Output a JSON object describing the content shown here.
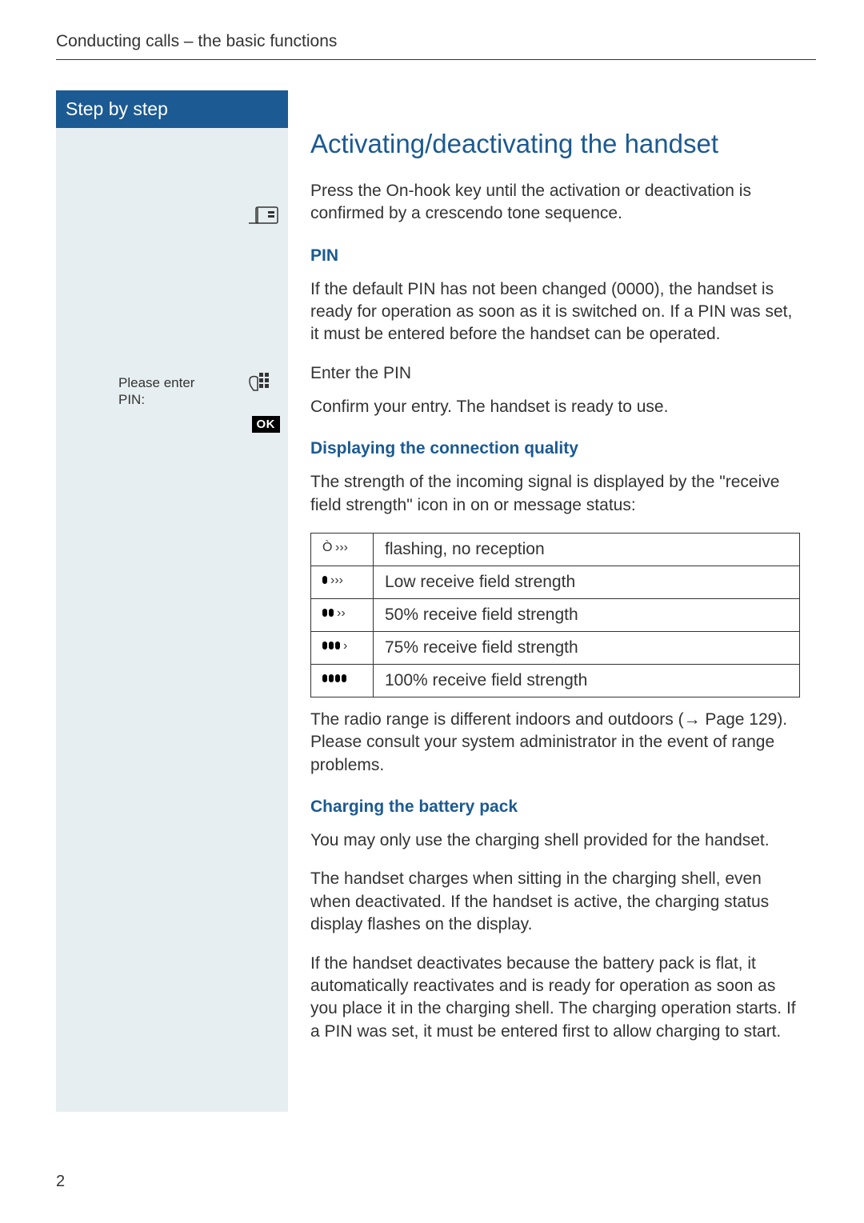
{
  "running_head": "Conducting calls – the basic functions",
  "sidebar": {
    "header": "Step by step",
    "pin_prompt_line1": "Please enter",
    "pin_prompt_line2": "PIN:",
    "ok_label": "OK"
  },
  "main": {
    "title": "Activating/deactivating the handset",
    "intro": "Press the On-hook key until the activation or deactivation is confirmed by a crescendo tone sequence.",
    "pin_heading": "PIN",
    "pin_body": "If the default PIN has not been changed (0000), the handset is ready for operation as soon as it is switched on. If a PIN was set, it must be entered before the handset can be operated.",
    "enter_pin": "Enter the PIN",
    "confirm_entry": "Confirm your entry. The handset is ready to use.",
    "conn_heading": "Displaying the connection quality",
    "conn_intro": "The strength of the incoming signal is displayed by the \"receive field strength\" icon in on or message status:",
    "signal_rows": [
      {
        "icon": "Ò",
        "text": "flashing, no reception"
      },
      {
        "icon": "•  ›››",
        "text": "Low receive field strength"
      },
      {
        "icon": "▪▪ ››",
        "text": "50% receive field strength"
      },
      {
        "icon": "▪▪▪ ›",
        "text": "75% receive field strength"
      },
      {
        "icon": "▪▪▪▪",
        "text": "100% receive field strength"
      }
    ],
    "conn_range": "The radio range is different indoors and outdoors (→ Page 129). Please consult your system administrator in the event of range problems.",
    "charge_heading": "Charging the battery pack",
    "charge_p1": "You may only use the charging shell provided for the handset.",
    "charge_p2": "The handset charges when sitting in the charging shell, even when deactivated. If the handset is active, the charging status display flashes on the display.",
    "charge_p3": "If the handset deactivates because the battery pack is flat, it automatically reactivates and is ready for operation as soon as you place it in the charging shell. The charging operation starts. If a PIN was set, it must be entered first to allow charging to start."
  },
  "page_number": "2"
}
